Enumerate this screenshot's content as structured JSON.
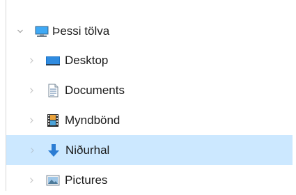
{
  "tree": {
    "root": {
      "label": "Þessi tölva",
      "icon": "computer-icon",
      "expanded": true
    },
    "items": [
      {
        "label": "Desktop",
        "icon": "desktop-folder-icon",
        "selected": false
      },
      {
        "label": "Documents",
        "icon": "documents-folder-icon",
        "selected": false
      },
      {
        "label": "Myndbönd",
        "icon": "videos-folder-icon",
        "selected": false
      },
      {
        "label": "Niðurhal",
        "icon": "downloads-folder-icon",
        "selected": true
      },
      {
        "label": "Pictures",
        "icon": "pictures-folder-icon",
        "selected": false
      }
    ]
  },
  "colors": {
    "selection_bg": "#cce8ff",
    "text": "#1b1b1b",
    "chevron": "#c8c8c8",
    "download_arrow": "#2b7cd3"
  }
}
